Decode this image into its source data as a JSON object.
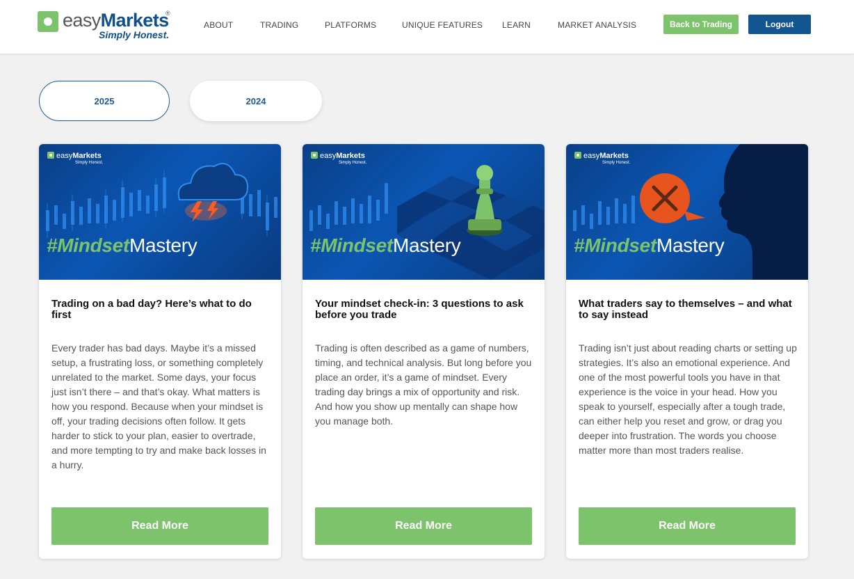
{
  "header": {
    "logo": {
      "prefix": "easy",
      "brand": "Markets",
      "reg": "®",
      "tagline": "Simply Honest."
    },
    "nav": [
      "ABOUT",
      "TRADING",
      "PLATFORMS",
      "UNIQUE FEATURES",
      "LEARN",
      "MARKET ANALYSIS"
    ],
    "back_label": "Back to Trading",
    "logout_label": "Logout"
  },
  "years": {
    "y2025": "2025",
    "y2024": "2024",
    "active": "2025"
  },
  "image": {
    "logo_prefix": "easy",
    "logo_brand": "Markets",
    "logo_tagline": "Simply Honest.",
    "hashtag": "#Mindset",
    "title_suffix": "Mastery"
  },
  "cards": [
    {
      "title": "Trading on a bad day? Here’s what to do first",
      "body": "Every trader has bad days. Maybe it’s a missed setup, a frustrating loss, or something completely unrelated to the market. Some days, your focus just isn’t there – and that’s okay. What matters is how you respond. Because when your mindset is off, your trading decisions often follow. It gets harder to stick to your plan, easier to overtrade, and more tempting to try and make back losses in a hurry.",
      "button": "Read More",
      "image_icon": "storm-cloud-icon"
    },
    {
      "title": "Your mindset check-in: 3 questions to ask before you trade",
      "body": "Trading is often described as a game of numbers, timing, and technical analysis. But long before you place an order, it’s a game of mindset. Every trading day brings a mix of opportunity and risk. And how you show up mentally can shape how you manage both.",
      "button": "Read More",
      "image_icon": "chess-pawn-icon"
    },
    {
      "title": "What traders say to themselves – and what to say instead",
      "body": "Trading isn’t just about reading charts or setting up strategies. It’s also an emotional experience. And one of the most powerful tools you have in that experience is the voice in your head. How you speak to yourself, especially after a tough trade, can either help you reset and grow, or drag you deeper into frustration. The words you choose matter more than most traders realise.",
      "button": "Read More",
      "image_icon": "speech-bubble-x-icon"
    }
  ],
  "colors": {
    "brand_green": "#7dc36b",
    "brand_blue": "#12558f",
    "image_blue": "#0b56b3",
    "accent_orange": "#e8541e"
  }
}
